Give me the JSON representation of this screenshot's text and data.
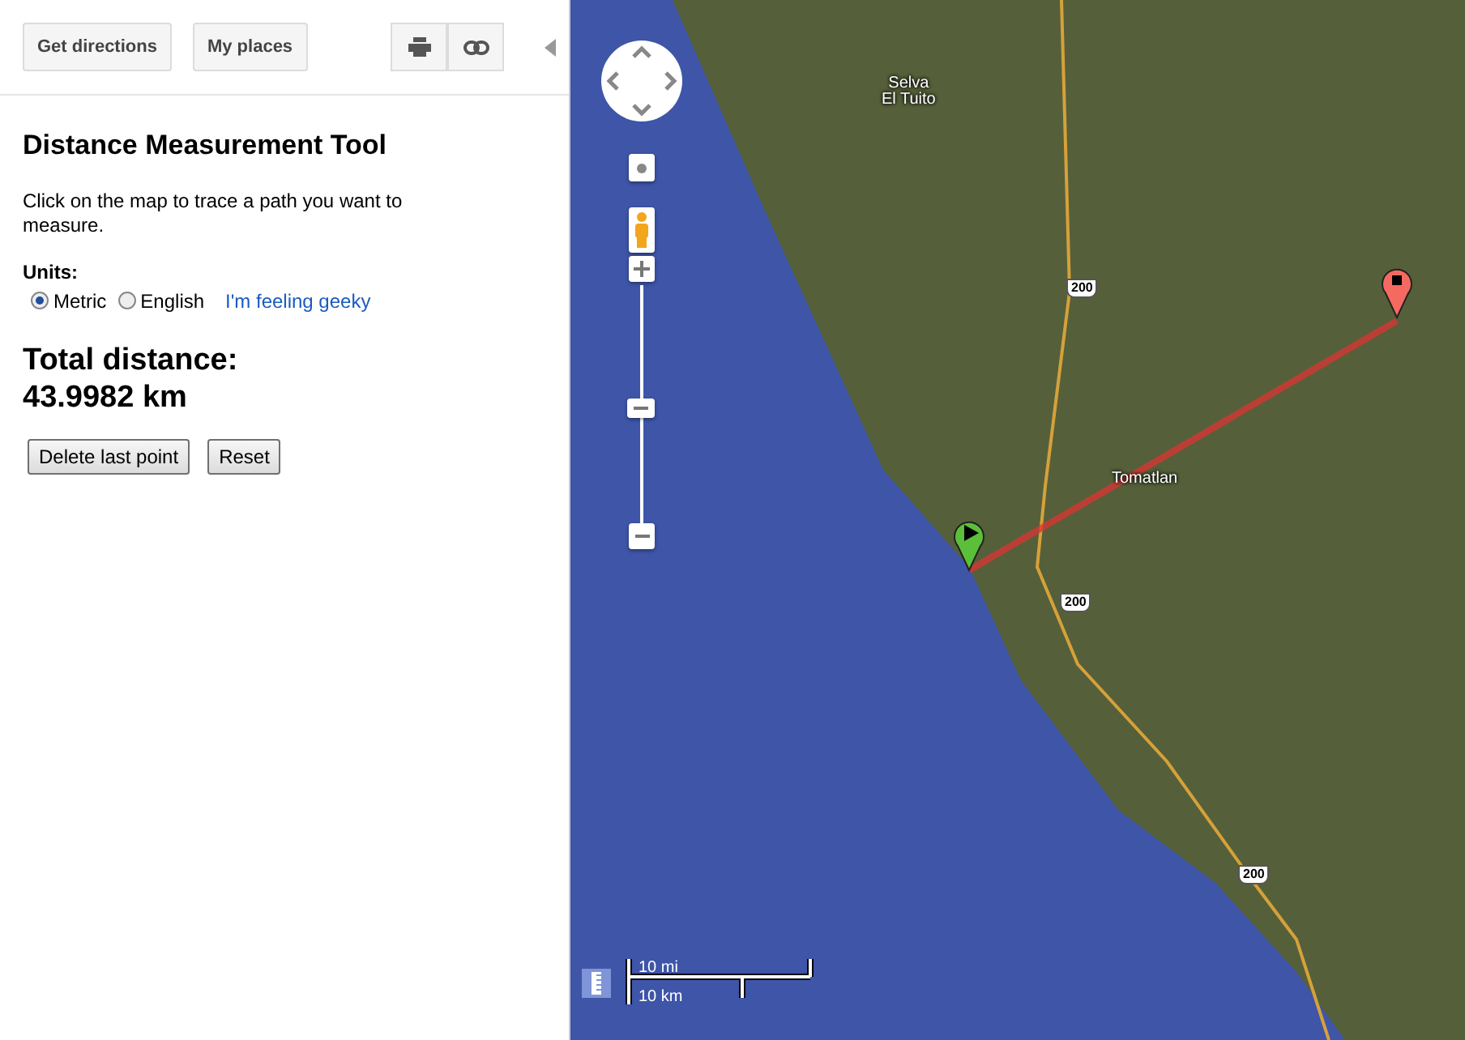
{
  "toolbar": {
    "buttons": [
      "Get directions",
      "My places"
    ]
  },
  "tool": {
    "title": "Distance Measurement Tool",
    "description": "Click on the map to trace a path you want to measure.",
    "units_label": "Units:",
    "units": [
      {
        "label": "Metric",
        "selected": true
      },
      {
        "label": "English",
        "selected": false
      }
    ],
    "geeky_link": "I'm feeling geeky",
    "total_label": "Total distance:",
    "total_value": "43.9982 km",
    "buttons": [
      "Delete last point",
      "Reset"
    ]
  },
  "map": {
    "labels": [
      {
        "text": "Selva\nEl Tuito",
        "kind": "place"
      },
      {
        "text": "Tomatlan",
        "kind": "place"
      },
      {
        "text": "200",
        "kind": "road"
      },
      {
        "text": "200",
        "kind": "road"
      },
      {
        "text": "200",
        "kind": "road"
      }
    ],
    "scale": {
      "top": "10 mi",
      "bottom": "10 km"
    }
  }
}
